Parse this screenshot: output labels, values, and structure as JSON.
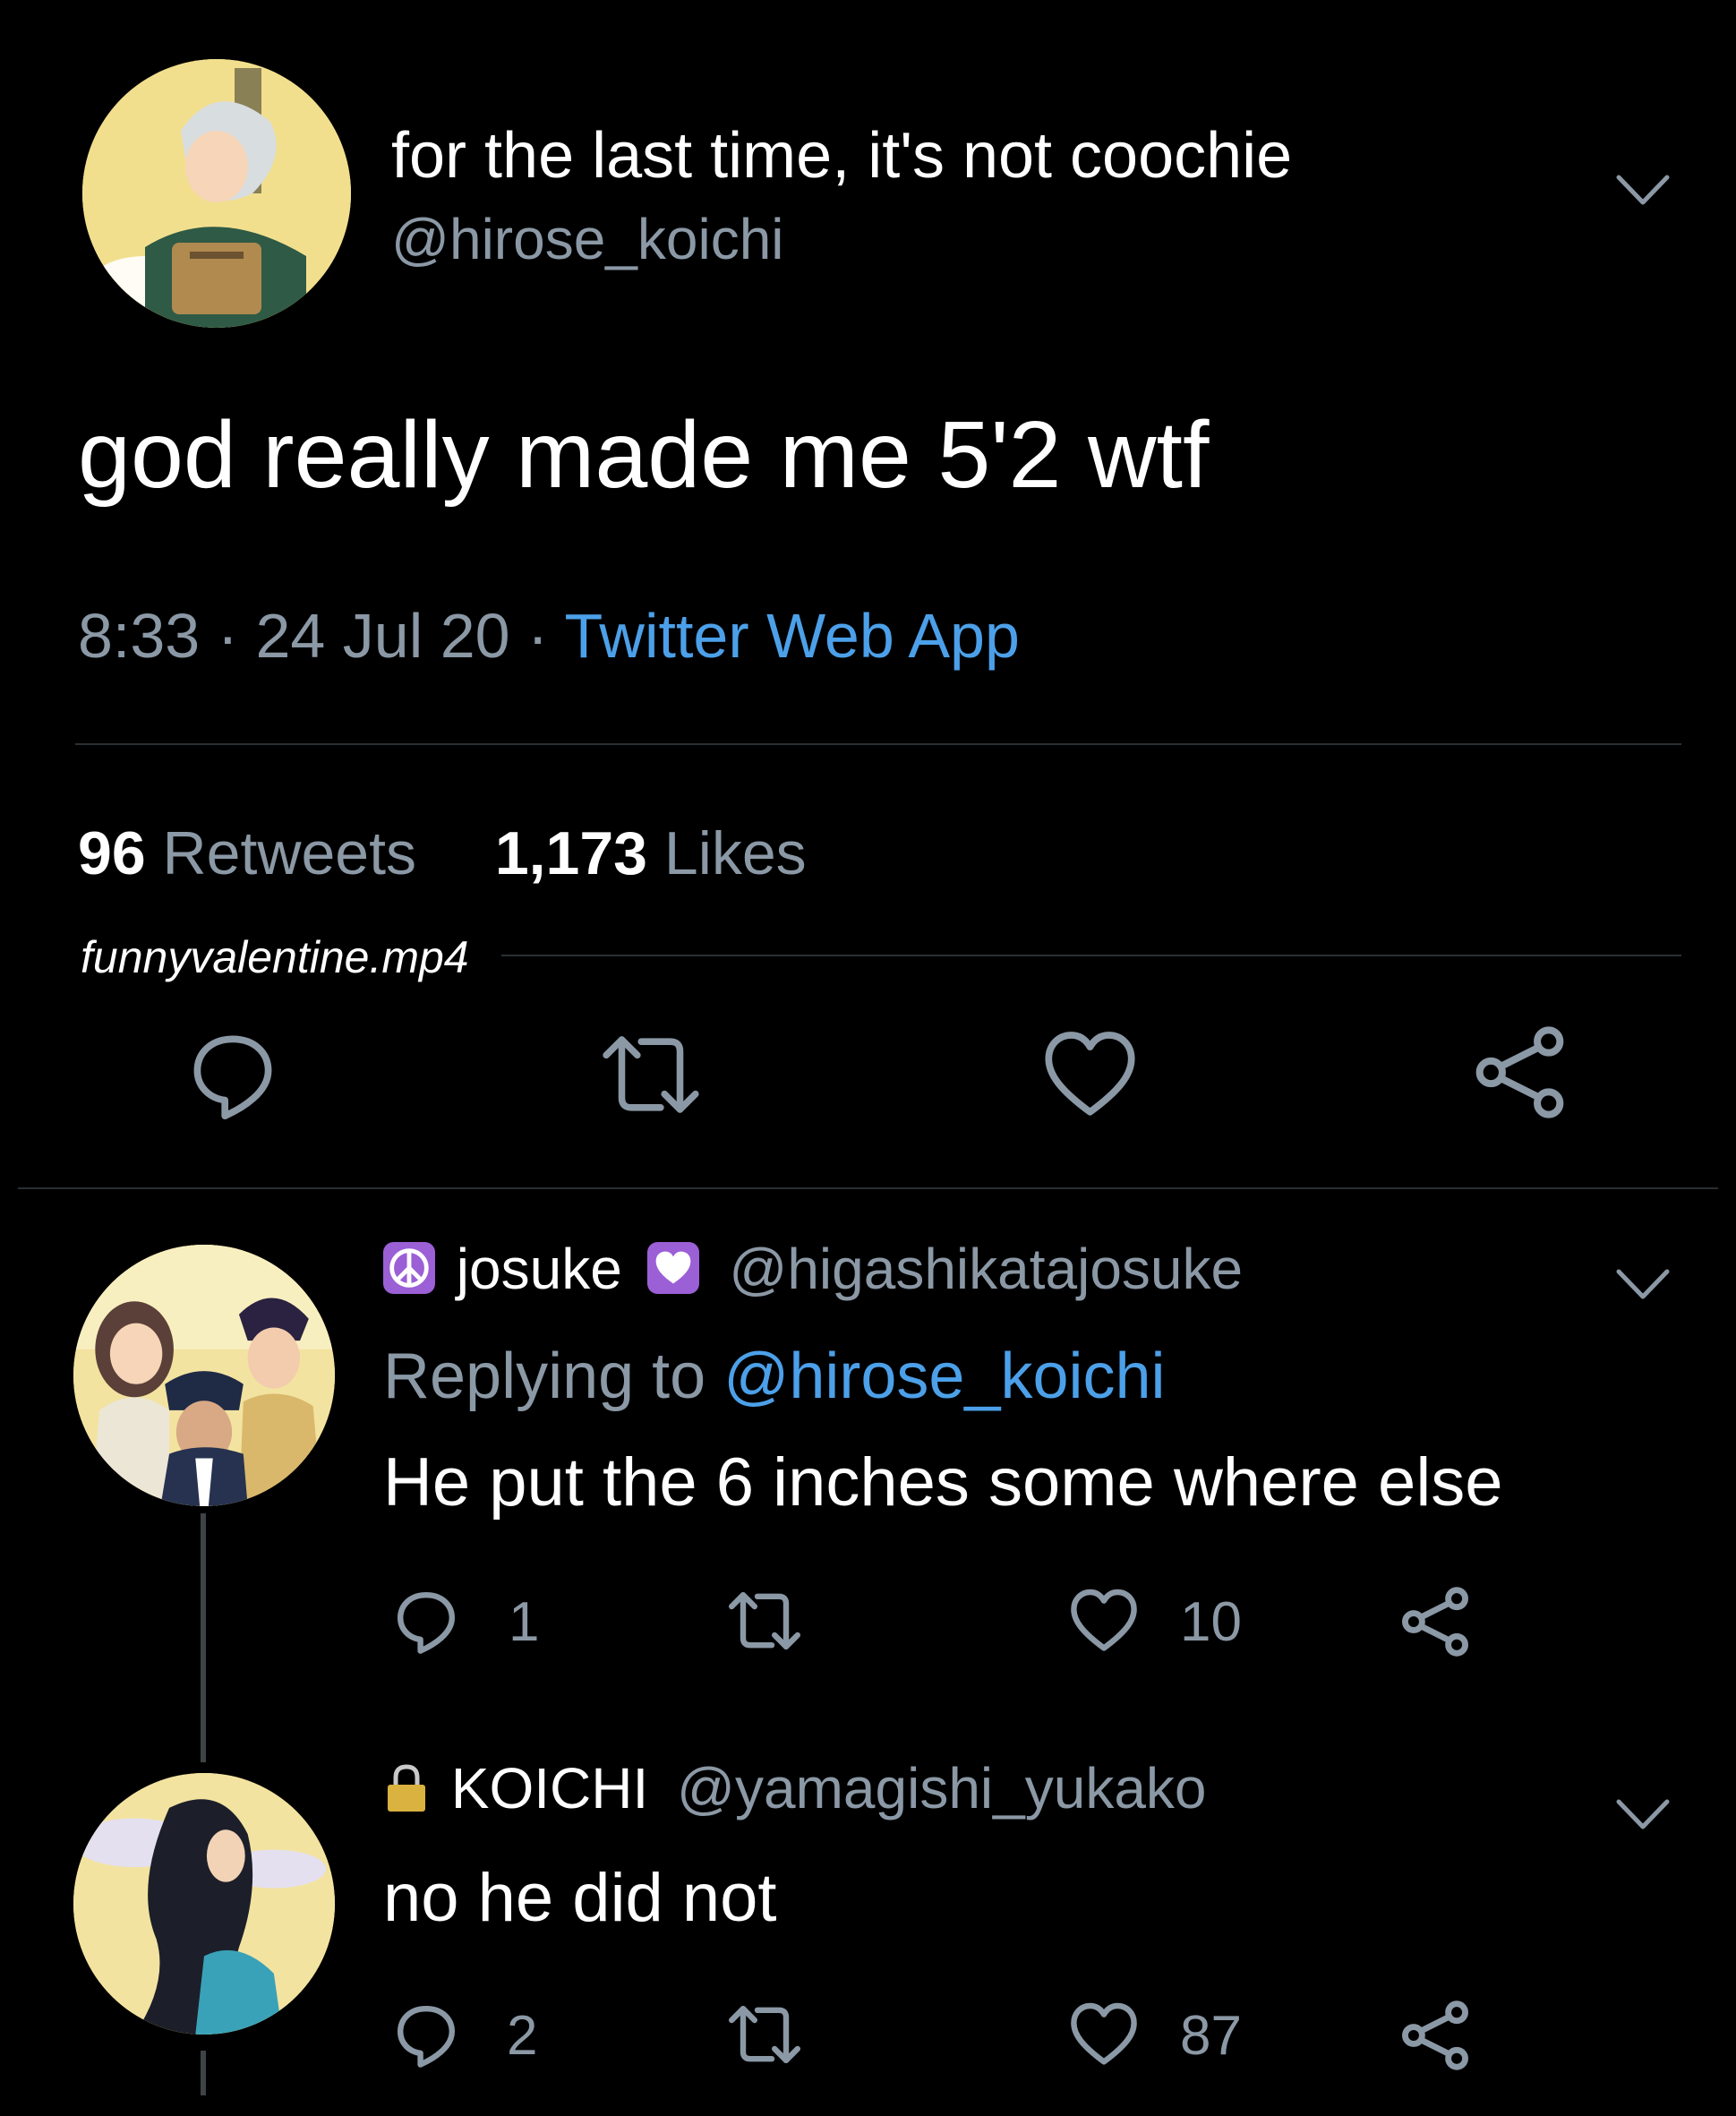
{
  "tweet": {
    "display_name": "for the last time, it's not coochie",
    "handle": "@hirose_koichi",
    "text": "god really made me 5'2 wtf",
    "time": "8:33",
    "date": "24 Jul 20",
    "separator": "·",
    "source": "Twitter Web App",
    "retweets_count": "96",
    "retweets_label": "Retweets",
    "likes_count": "1,173",
    "likes_label": "Likes",
    "watermark": "funnyvalentine.mp4"
  },
  "replies": [
    {
      "display_name": "josuke",
      "handle": "@higashikatajosuke",
      "replying_label": "Replying to",
      "replying_to": "@hirose_koichi",
      "text": "He put the 6 inches some where else",
      "reply_count": "1",
      "like_count": "10"
    },
    {
      "display_name": "KOICHI",
      "handle": "@yamagishi_yukako",
      "text": "no he did not",
      "reply_count": "2",
      "like_count": "87"
    }
  ],
  "icons": [
    "chevron-down-icon",
    "reply-icon",
    "retweet-icon",
    "like-icon",
    "share-icon",
    "peace-icon",
    "purple-heart-icon",
    "lock-icon"
  ],
  "colors": {
    "background": "#000000",
    "text": "#ffffff",
    "muted": "#8b98a5",
    "link": "#4ca0e9",
    "divider": "#2a2f33"
  }
}
